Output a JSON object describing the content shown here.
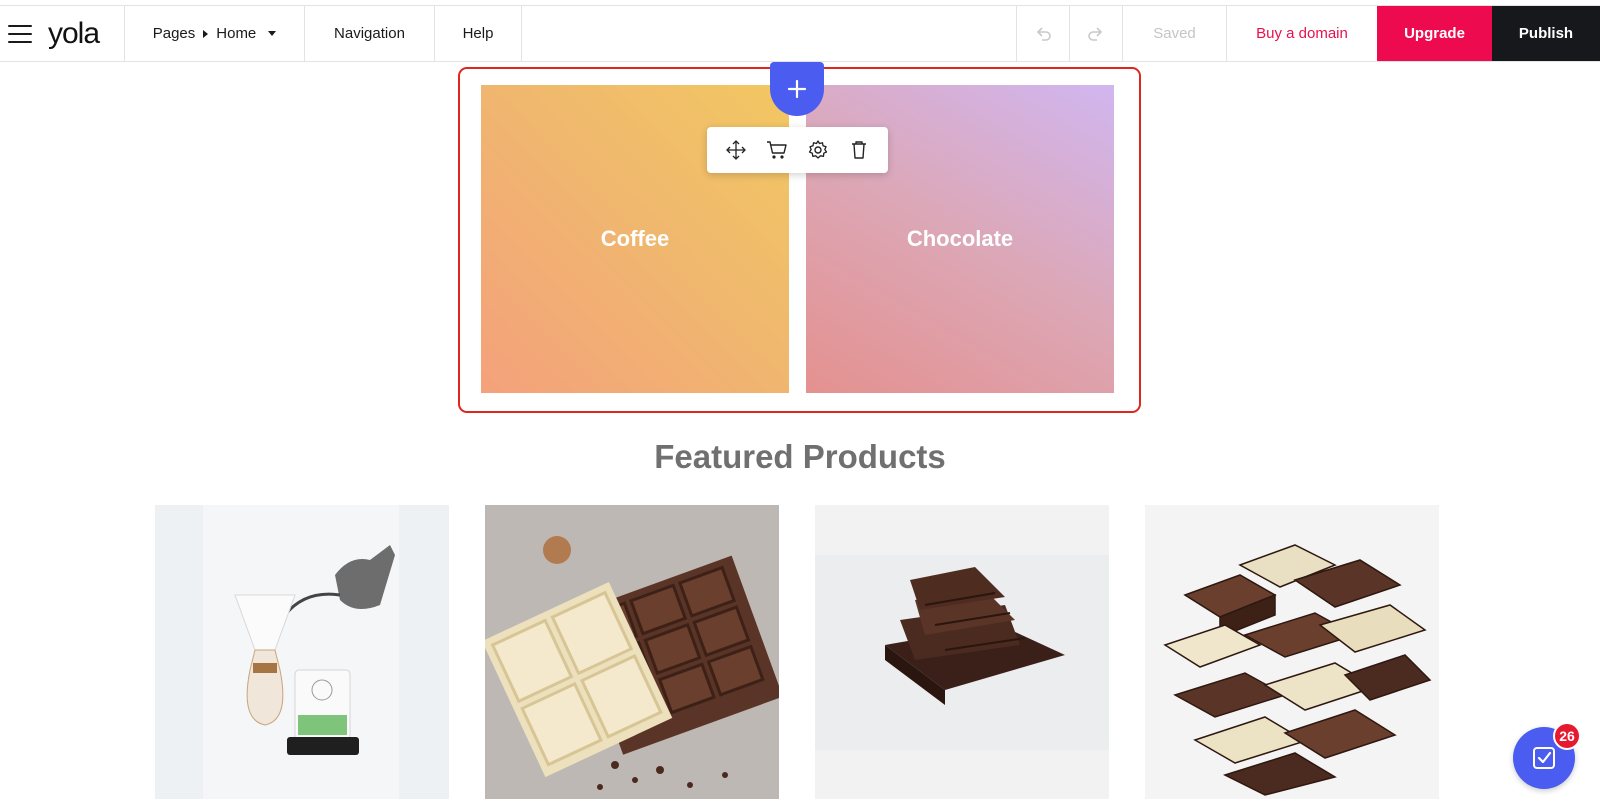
{
  "header": {
    "logo": "yola",
    "pages_label": "Pages",
    "current_page": "Home",
    "navigation_label": "Navigation",
    "help_label": "Help",
    "saved_label": "Saved",
    "buy_domain_label": "Buy a domain",
    "upgrade_label": "Upgrade",
    "publish_label": "Publish"
  },
  "section": {
    "tiles": [
      {
        "label": "Coffee"
      },
      {
        "label": "Chocolate"
      }
    ],
    "toolbar": [
      "move-icon",
      "cart-icon",
      "gear-icon",
      "trash-icon"
    ]
  },
  "featured": {
    "title": "Featured Products"
  },
  "checklist": {
    "badge_count": "26"
  },
  "colors": {
    "accent_blue": "#4a5df0",
    "upgrade_pink": "#ee0a4e",
    "publish_dark": "#16181b",
    "selection_red": "#e0261f"
  }
}
